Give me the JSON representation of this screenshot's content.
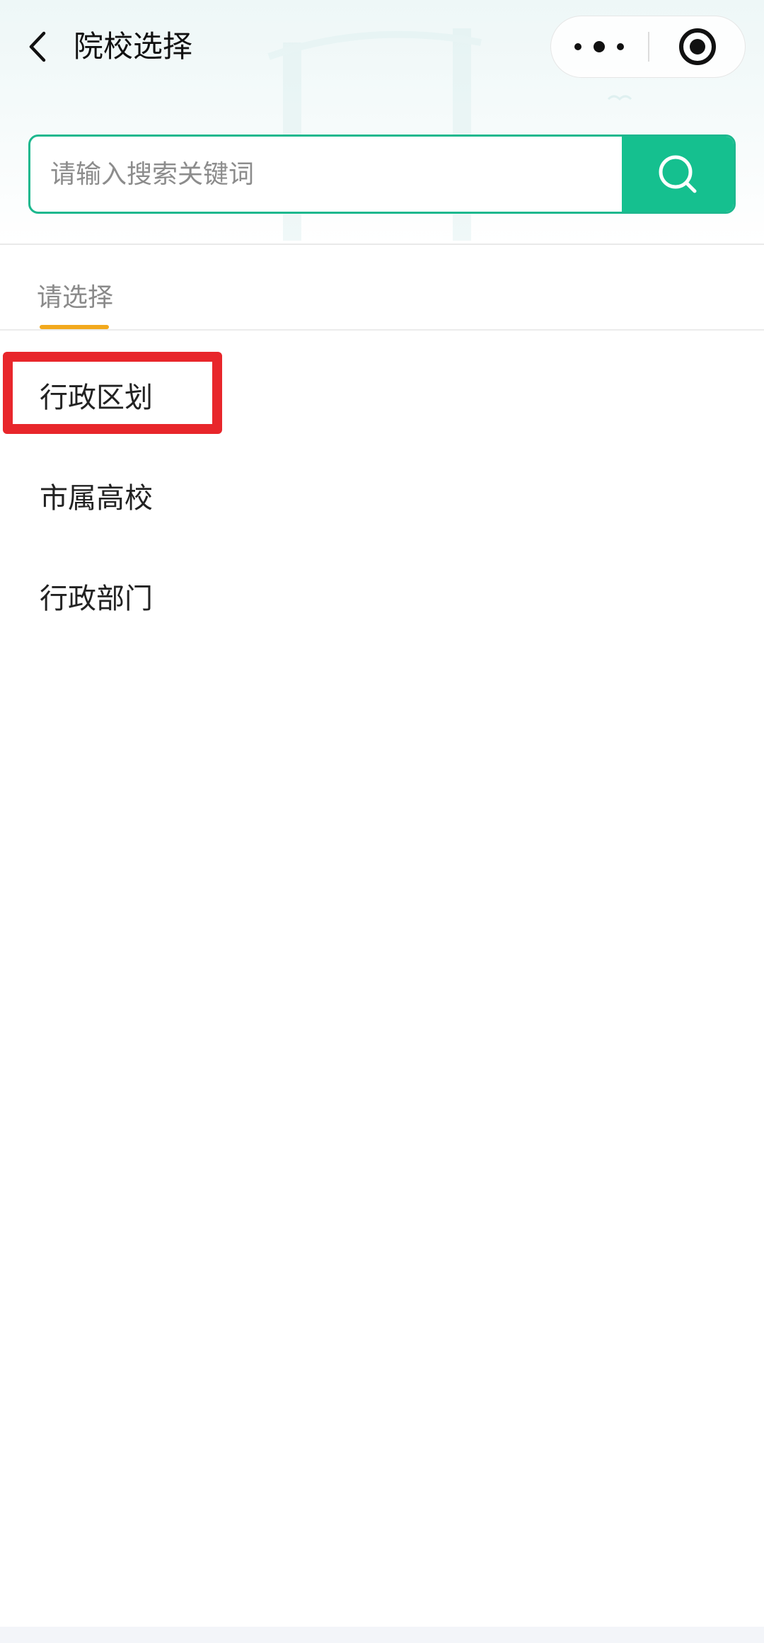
{
  "header": {
    "title": "院校选择",
    "back_icon": "chevron-left-icon"
  },
  "capsule": {
    "more_icon": "more-dots-icon",
    "close_icon": "target-circle-icon"
  },
  "search": {
    "placeholder": "请输入搜索关键词",
    "value": "",
    "button_icon": "search-icon"
  },
  "tabs": {
    "active_label": "请选择"
  },
  "options": [
    {
      "label": "行政区划"
    },
    {
      "label": "市属高校"
    },
    {
      "label": "行政部门"
    }
  ],
  "colors": {
    "accent_green": "#15c08f",
    "tab_underline": "#f2a91d",
    "highlight_red": "#e8262b"
  }
}
